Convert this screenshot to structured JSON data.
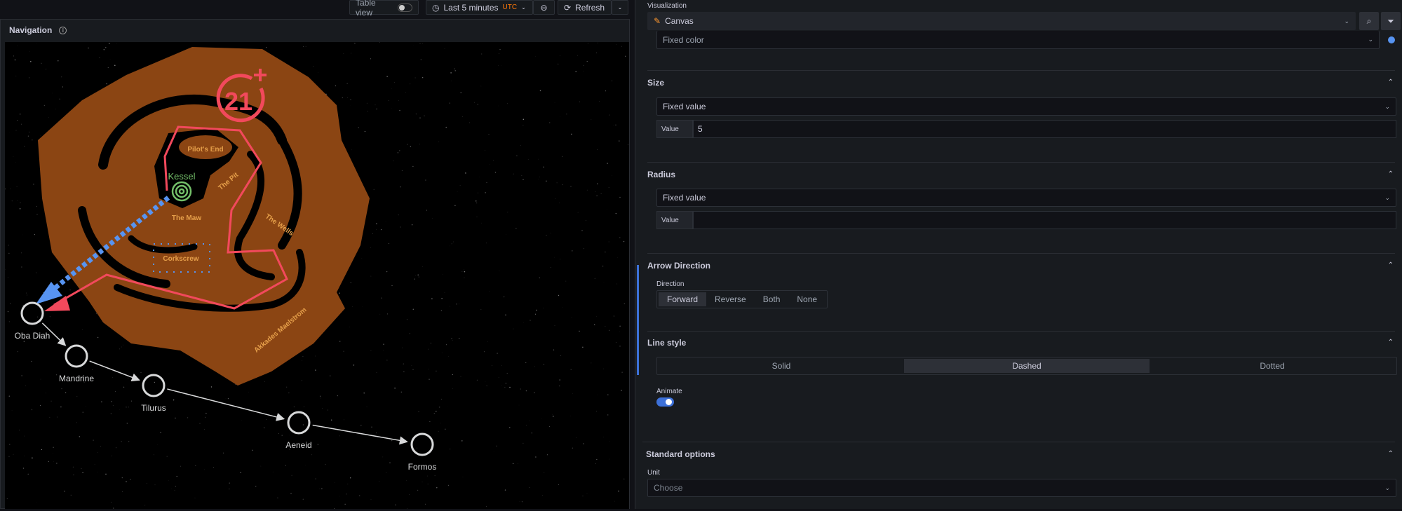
{
  "toolbar": {
    "table_view": "Table view",
    "time_range": "Last 5 minutes",
    "timezone": "UTC",
    "refresh": "Refresh"
  },
  "panel": {
    "title": "Navigation"
  },
  "map": {
    "logo_text": "21+",
    "kessel": "Kessel",
    "regions": {
      "pilots_end": "Pilot's End",
      "the_pit": "The Pit",
      "the_maw": "The Maw",
      "corkscrew": "Corkscrew",
      "the_wells": "The Wells",
      "akkades": "Akkades Maelstrom"
    },
    "nodes": [
      {
        "name": "Oba Diah"
      },
      {
        "name": "Mandrine"
      },
      {
        "name": "Tilurus"
      },
      {
        "name": "Aeneid"
      },
      {
        "name": "Formos"
      }
    ],
    "colors": {
      "rock": "#8b4513",
      "route": "#f2495c",
      "arrow": "#5794f2",
      "kessel": "#73bf69",
      "node": "#d8d9da"
    }
  },
  "options": {
    "visualization_label": "Visualization",
    "visualization": "Canvas",
    "color_mode": "Fixed color",
    "color_value": "#5794f2",
    "size": {
      "title": "Size",
      "mode": "Fixed value",
      "value_label": "Value",
      "value": "5"
    },
    "radius": {
      "title": "Radius",
      "mode": "Fixed value",
      "value_label": "Value",
      "value": ""
    },
    "arrow": {
      "title": "Arrow Direction",
      "label": "Direction",
      "options": [
        "Forward",
        "Reverse",
        "Both",
        "None"
      ],
      "selected": "Forward"
    },
    "line_style": {
      "title": "Line style",
      "options": [
        "Solid",
        "Dashed",
        "Dotted"
      ],
      "selected": "Dashed",
      "animate_label": "Animate",
      "animate": true
    },
    "standard": {
      "title": "Standard options",
      "unit_label": "Unit",
      "unit_placeholder": "Choose"
    }
  }
}
